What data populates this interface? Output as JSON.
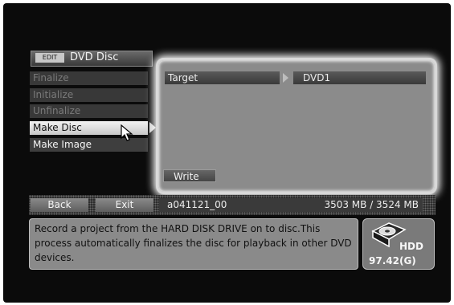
{
  "header": {
    "badge": "EDIT",
    "title": "DVD Disc"
  },
  "menu": {
    "items": [
      {
        "label": "Finalize",
        "state": "disabled"
      },
      {
        "label": "Initialize",
        "state": "disabled"
      },
      {
        "label": "Unfinalize",
        "state": "disabled"
      },
      {
        "label": "Make Disc",
        "state": "selected"
      },
      {
        "label": "Make Image",
        "state": "enabled"
      }
    ]
  },
  "panel": {
    "target_label": "Target",
    "target_value": "DVD1",
    "write_label": "Write"
  },
  "status_bar": {
    "back_label": "Back",
    "exit_label": "Exit",
    "project_name": "a041121_00",
    "size_text": "3503 MB / 3524 MB"
  },
  "description": {
    "text": "Record a project from the HARD DISK DRIVE on to disc.This process automatically finalizes the disc for playback in other DVD devices."
  },
  "hdd": {
    "label": "HDD",
    "capacity": "97.42(G)"
  },
  "icons": {
    "cursor": "mouse-pointer-icon",
    "arrow": "chevron-right-icon",
    "drive": "hard-disk-icon"
  }
}
